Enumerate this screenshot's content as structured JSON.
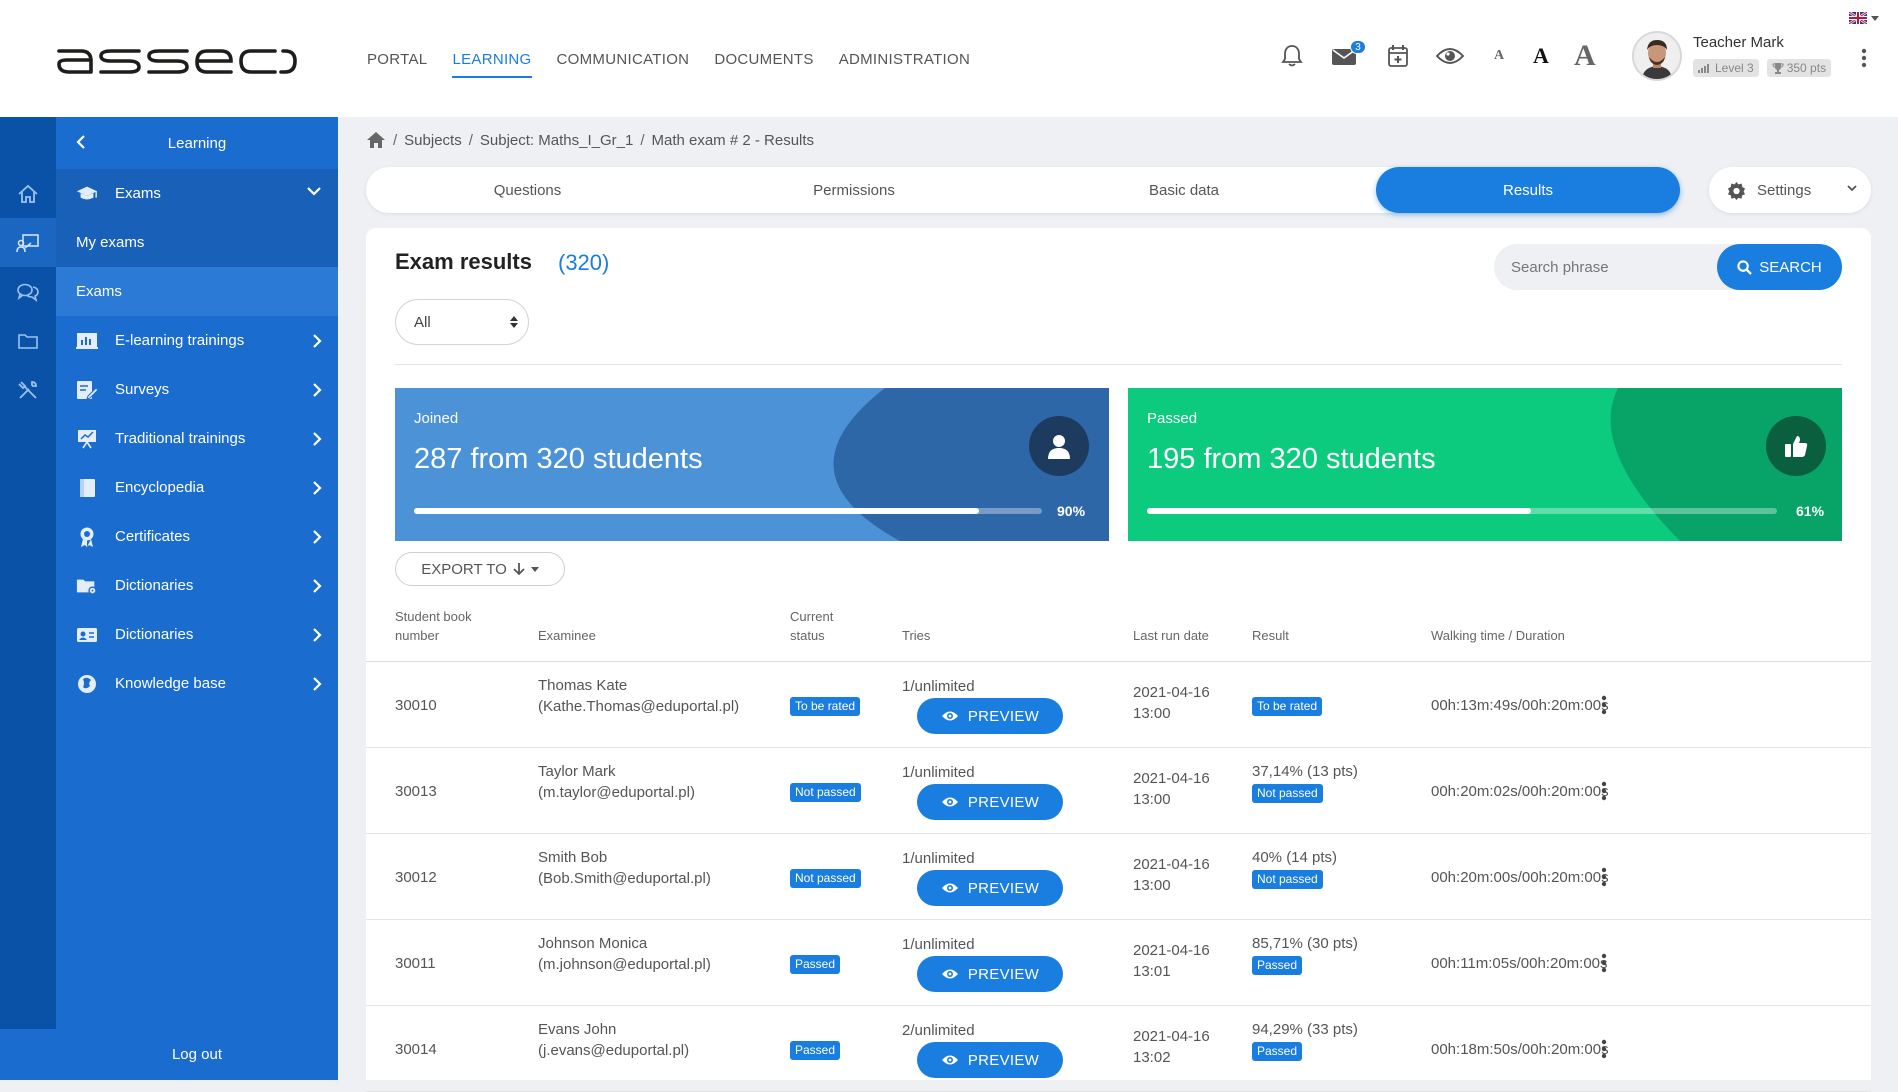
{
  "header": {
    "logo_text": "asseco",
    "nav": [
      "PORTAL",
      "LEARNING",
      "COMMUNICATION",
      "DOCUMENTS",
      "ADMINISTRATION"
    ],
    "active_nav": "LEARNING",
    "mail_count": "3",
    "font_sizes": [
      "A",
      "A",
      "A"
    ],
    "user": {
      "name": "Teacher Mark",
      "level": "Level 3",
      "points": "350 pts"
    }
  },
  "sidebar": {
    "title": "Learning",
    "exams_label": "Exams",
    "sub_items": [
      "My exams",
      "Exams"
    ],
    "items": [
      "E-learning trainings",
      "Surveys",
      "Traditional trainings",
      "Encyclopedia",
      "Certificates",
      "Dictionaries",
      "Dictionaries",
      "Knowledge base"
    ],
    "logout": "Log out"
  },
  "breadcrumb": [
    "Subjects",
    "Subject: Maths_I_Gr_1",
    "Math exam # 2 - Results"
  ],
  "tabs": [
    "Questions",
    "Permissions",
    "Basic data",
    "Results"
  ],
  "active_tab": "Results",
  "settings_label": "Settings",
  "main": {
    "title": "Exam results",
    "count": "(320)",
    "search_placeholder": "Search phrase",
    "search_label": "SEARCH",
    "filter_value": "All",
    "export_label": "EXPORT TO"
  },
  "stats": {
    "joined": {
      "label": "Joined",
      "text": "287 from 320 students",
      "percent_label": "90%",
      "fraction": 0.9,
      "color": "#4b92d6"
    },
    "passed": {
      "label": "Passed",
      "text": "195 from 320 students",
      "percent_label": "61%",
      "fraction": 0.61,
      "color": "#0ccb7e"
    }
  },
  "table": {
    "headers": {
      "book_1": "Student book",
      "book_2": "number",
      "examinee": "Examinee",
      "status_1": "Current",
      "status_2": "status",
      "tries": "Tries",
      "last_run": "Last run date",
      "result": "Result",
      "walking": "Walking time / Duration"
    },
    "preview_label": "PREVIEW",
    "rows": [
      {
        "book": "30010",
        "name": "Thomas Kate",
        "email": "(Kathe.Thomas@eduportal.pl)",
        "status": "To be rated",
        "tries": "1/unlimited",
        "date": "2021-04-16",
        "time": "13:00",
        "result": "",
        "result_badge": "To be rated",
        "walking": "00h:13m:49s/00h:20m:00s"
      },
      {
        "book": "30013",
        "name": "Taylor Mark",
        "email": "(m.taylor@eduportal.pl)",
        "status": "Not passed",
        "tries": "1/unlimited",
        "date": "2021-04-16",
        "time": "13:00",
        "result": "37,14% (13 pts)",
        "result_badge": "Not passed",
        "walking": "00h:20m:02s/00h:20m:00s"
      },
      {
        "book": "30012",
        "name": "Smith Bob",
        "email": "(Bob.Smith@eduportal.pl)",
        "status": "Not passed",
        "tries": "1/unlimited",
        "date": "2021-04-16",
        "time": "13:00",
        "result": "40% (14 pts)",
        "result_badge": "Not passed",
        "walking": "00h:20m:00s/00h:20m:00s"
      },
      {
        "book": "30011",
        "name": "Johnson Monica",
        "email": "(m.johnson@eduportal.pl)",
        "status": "Passed",
        "tries": "1/unlimited",
        "date": "2021-04-16",
        "time": "13:01",
        "result": "85,71% (30 pts)",
        "result_badge": "Passed",
        "walking": "00h:11m:05s/00h:20m:00s"
      },
      {
        "book": "30014",
        "name": "Evans John",
        "email": "(j.evans@eduportal.pl)",
        "status": "Passed",
        "tries": "2/unlimited",
        "date": "2021-04-16",
        "time": "13:02",
        "result": "94,29% (33 pts)",
        "result_badge": "Passed",
        "walking": "00h:18m:50s/00h:20m:00s"
      }
    ]
  },
  "colors": {
    "accent": "#1a7de0",
    "sidebar": "#1b6ccf",
    "rail": "#0a52a8"
  }
}
